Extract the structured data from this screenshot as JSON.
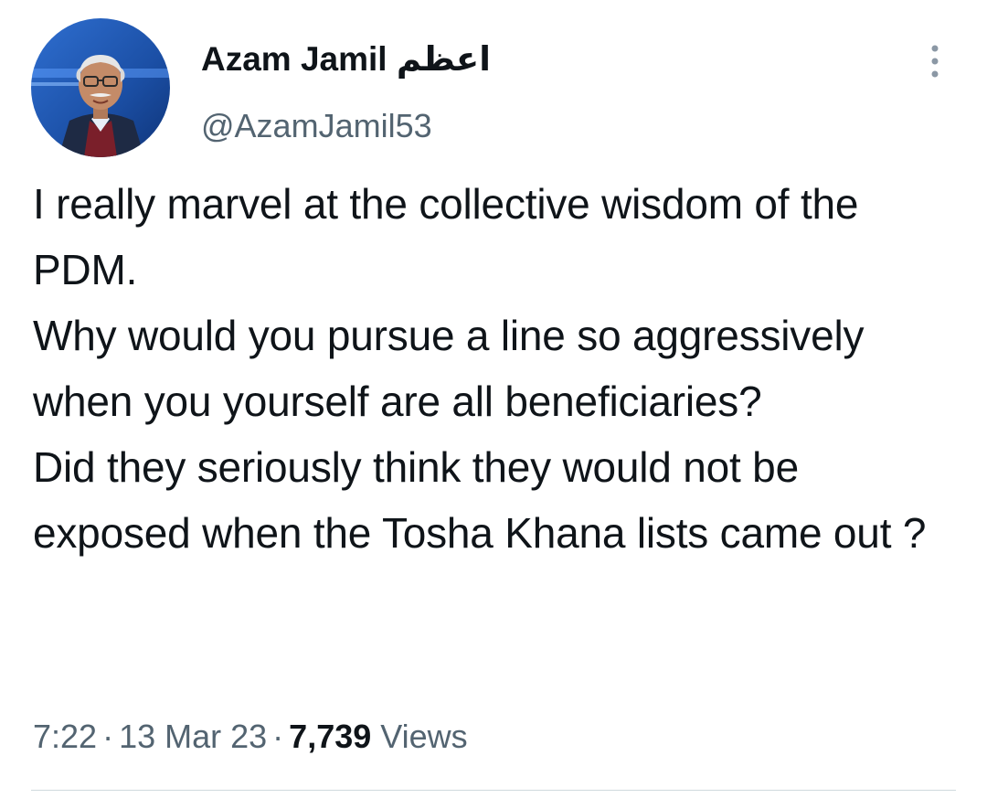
{
  "author": {
    "display_name": "Azam Jamil اعظم",
    "handle": "@AzamJamil53"
  },
  "tweet": {
    "text": "I really marvel at the collective wisdom of the PDM.\nWhy would you pursue a line so aggressively when you yourself are all beneficiaries?\nDid they seriously think they would not be exposed when the Tosha Khana lists came out ?"
  },
  "meta": {
    "time": "7:22",
    "date": "13 Mar 23",
    "views_count": "7,739",
    "views_label": "Views",
    "separator": "·"
  },
  "icons": {
    "more": "more-options-icon"
  },
  "colors": {
    "text_primary": "#0f1419",
    "text_secondary": "#536471",
    "divider": "#cfd9de"
  }
}
